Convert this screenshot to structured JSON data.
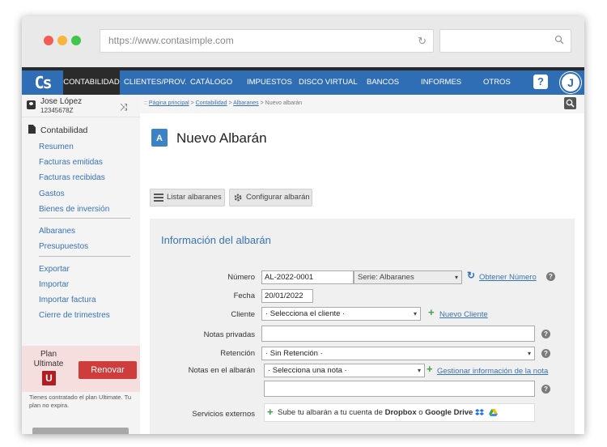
{
  "browser": {
    "url": "https://www.contasimple.com"
  },
  "logo": "Cs",
  "nav": {
    "items": [
      "CONTABILIDAD",
      "CLIENTES/PROV.",
      "CATÁLOGO",
      "IMPUESTOS",
      "DISCO VIRTUAL",
      "BANCOS",
      "INFORMES",
      "OTROS"
    ],
    "active": "CONTABILIDAD",
    "help": "?",
    "avatar": "J"
  },
  "user": {
    "name": "Jose López",
    "nif": "12345678Z"
  },
  "sidebar": {
    "section": "Contabilidad",
    "group1": [
      "Resumen",
      "Facturas emitidas",
      "Facturas recibidas",
      "Gastos",
      "Bienes de inversión"
    ],
    "group2": [
      "Albaranes",
      "Presupuestos"
    ],
    "group3": [
      "Exportar",
      "Importar",
      "Importar factura",
      "Cierre de trimestres"
    ]
  },
  "plan": {
    "label": "Plan",
    "name": "Ultimate",
    "badge": "U",
    "renew": "Renovar",
    "note": "Tienes contratado el plan Ultimate. Tu plan no expira."
  },
  "breadcrumb": {
    "prefix": "::",
    "items": [
      "Página principal",
      "Contabilidad",
      "Albaranes"
    ],
    "current": "Nuevo albarán"
  },
  "page": {
    "icon_letter": "A",
    "title": "Nuevo Albarán"
  },
  "toolbar": {
    "list": "Listar albaranes",
    "config": "Configurar albarán"
  },
  "form": {
    "section_title": "Información del albarán",
    "numero_label": "Número",
    "numero_value": "AL-2022-0001",
    "serie_value": "Serie: Albaranes",
    "obtener": "Obtener Número",
    "fecha_label": "Fecha",
    "fecha_value": "20/01/2022",
    "cliente_label": "Cliente",
    "cliente_value": "· Selecciona el cliente ·",
    "nuevo_cliente": "Nuevo Cliente",
    "notas_privadas_label": "Notas privadas",
    "retencion_label": "Retención",
    "retencion_value": "· Sin Retención ·",
    "notas_albaran_label": "Notas en el albarán",
    "notas_albaran_value": "· Selecciona una nota ·",
    "gestionar": "Gestionar información de la nota",
    "servicios_label": "Servicios externos",
    "servicios_text_pre": "Sube tu albarán a tu cuenta de ",
    "dropbox": "Dropbox",
    "o": " o ",
    "gdrive": "Google Drive"
  },
  "colors": {
    "nav": "#2f6eb5",
    "link": "#3973b4",
    "renew": "#cf3c3c",
    "plan_bg": "#f6dede",
    "badge": "#b01d23"
  }
}
